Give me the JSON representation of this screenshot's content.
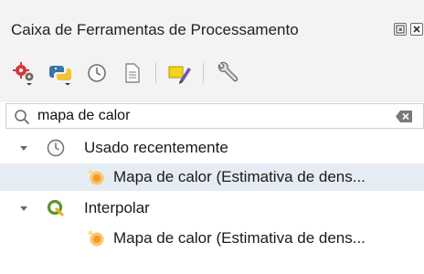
{
  "panel": {
    "title": "Caixa de Ferramentas de Processamento"
  },
  "title_buttons": [
    {
      "name": "float-panel",
      "icon": "float-icon"
    },
    {
      "name": "close-panel",
      "icon": "close-icon"
    }
  ],
  "toolbar": {
    "buttons": [
      {
        "name": "models-button",
        "icon": "gears-icon"
      },
      {
        "name": "scripts-button",
        "icon": "python-icon"
      },
      {
        "name": "history-button",
        "icon": "clock-icon"
      },
      {
        "name": "results-viewer-button",
        "icon": "document-icon"
      },
      {
        "name": "edit-features-in-place-button",
        "icon": "pencil-highlighter-icon"
      },
      {
        "name": "options-button",
        "icon": "wrench-icon"
      }
    ]
  },
  "search": {
    "value": "mapa de calor",
    "icon": "search-icon",
    "clear_icon": "clear-icon"
  },
  "tree": {
    "groups": [
      {
        "label": "Usado recentemente",
        "icon": "clock-icon",
        "expanded": true,
        "items": [
          {
            "label": "Mapa de calor (Estimativa de dens...",
            "icon": "heatmap-icon",
            "selected": true
          }
        ]
      },
      {
        "label": "Interpolar",
        "icon": "qgis-icon",
        "expanded": true,
        "items": [
          {
            "label": "Mapa de calor (Estimativa de dens...",
            "icon": "heatmap-icon",
            "selected": false
          }
        ]
      }
    ]
  },
  "colors": {
    "panel_bg": "#f3f3f3",
    "selected_row": "#e6ecf4",
    "qgis_green": "#589632",
    "python_blue": "#3b74a6",
    "python_yellow": "#f2c335"
  }
}
